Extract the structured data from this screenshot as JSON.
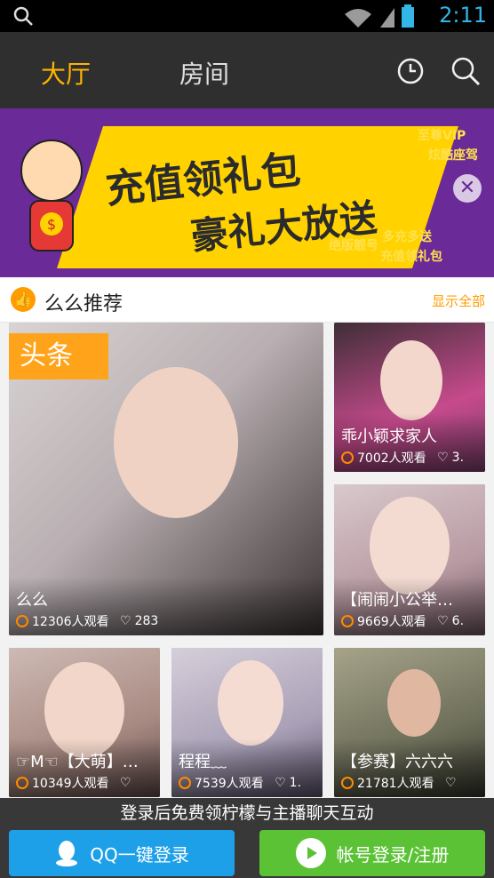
{
  "statusbar": {
    "time": "2:11"
  },
  "tabs": {
    "hall": "大厅",
    "room": "房间"
  },
  "banner": {
    "line1": "充值领礼包",
    "line2": "豪礼大放送",
    "small1": "至尊VIP",
    "small2": "炫酷座驾",
    "small3": "绝版靓号",
    "small4": "多充多送",
    "small5": "充值领礼包"
  },
  "section": {
    "title": "么么推荐",
    "more": "显示全部"
  },
  "cards": [
    {
      "name": "么么",
      "views": "12306人观看",
      "likes": "283",
      "badge": "头条"
    },
    {
      "name": "乖小颖求家人",
      "views": "7002人观看",
      "likes": "3."
    },
    {
      "name": "【闹闹小公举…",
      "views": "9669人观看",
      "likes": "6."
    },
    {
      "name": "☞M☜【大萌】…",
      "views": "10349人观看",
      "likes": ""
    },
    {
      "name": "程程﹏",
      "views": "7539人观看",
      "likes": "1."
    },
    {
      "name": "【参赛】六六六",
      "views": "21781人观看",
      "likes": ""
    }
  ],
  "bottom": {
    "message": "登录后免费领柠檬与主播聊天互动",
    "qq_login": "QQ一键登录",
    "account_login": "帐号登录/注册"
  },
  "colors": {
    "accent": "#ffb400",
    "qq": "#1ea0e8",
    "account": "#5bc236"
  }
}
